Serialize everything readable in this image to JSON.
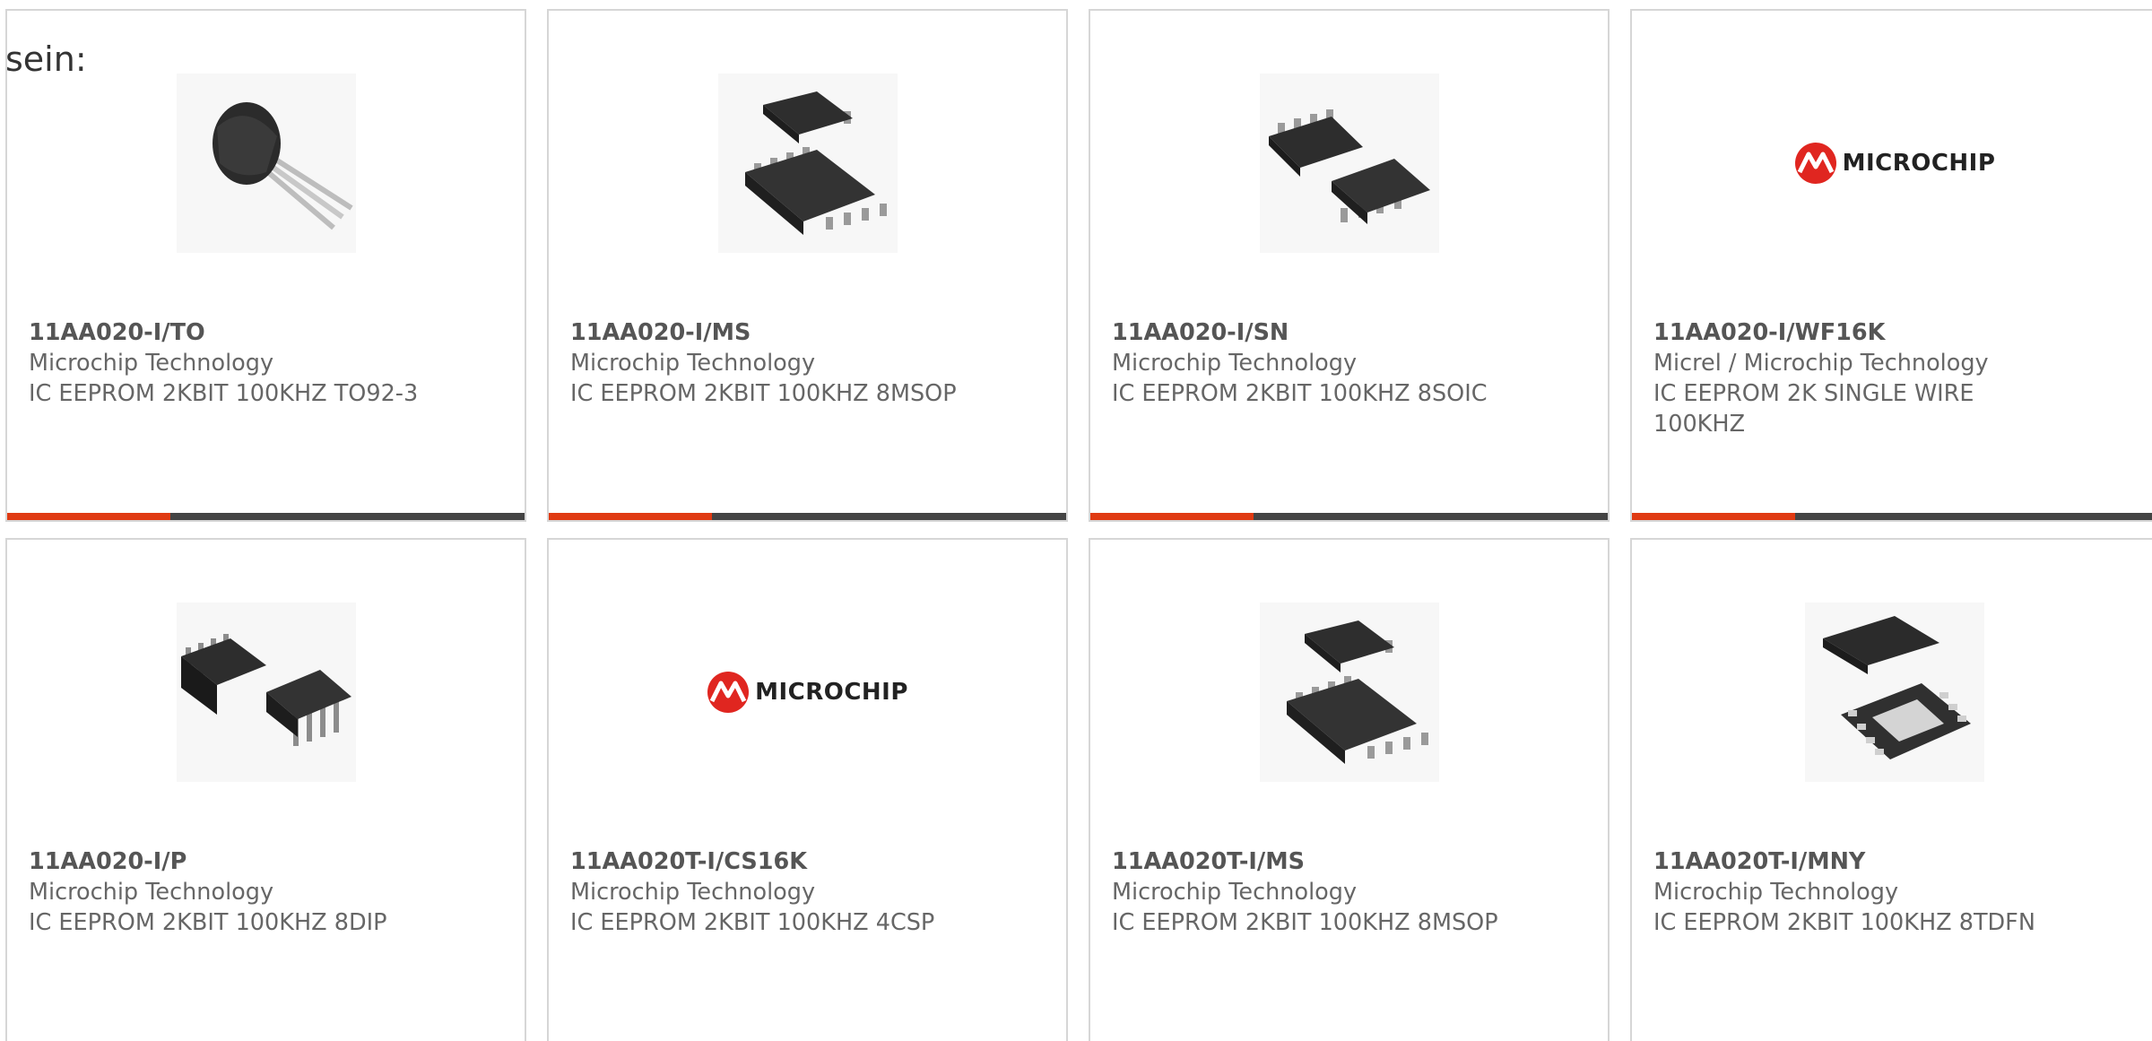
{
  "prefix_text": "sein:",
  "products": [
    {
      "part": "11AA020-I/TO",
      "maker": "Microchip Technology",
      "desc": "IC EEPROM 2KBIT 100KHZ TO92-3",
      "image_icon": "to92-package-icon"
    },
    {
      "part": "11AA020-I/MS",
      "maker": "Microchip Technology",
      "desc": "IC EEPROM 2KBIT 100KHZ 8MSOP",
      "image_icon": "msop-package-icon"
    },
    {
      "part": "11AA020-I/SN",
      "maker": "Microchip Technology",
      "desc": "IC EEPROM 2KBIT 100KHZ 8SOIC",
      "image_icon": "soic-package-icon"
    },
    {
      "part": "11AA020-I/WF16K",
      "maker": "Micrel / Microchip Technology",
      "desc": "IC EEPROM 2K SINGLE WIRE 100KHZ",
      "image_icon": "microchip-logo-icon",
      "logo_text": "MICROCHIP"
    },
    {
      "part": "11AA020-I/P",
      "maker": "Microchip Technology",
      "desc": "IC EEPROM 2KBIT 100KHZ 8DIP",
      "image_icon": "dip-package-icon"
    },
    {
      "part": "11AA020T-I/CS16K",
      "maker": "Microchip Technology",
      "desc": "IC EEPROM 2KBIT 100KHZ 4CSP",
      "image_icon": "microchip-logo-icon",
      "logo_text": "MICROCHIP"
    },
    {
      "part": "11AA020T-I/MS",
      "maker": "Microchip Technology",
      "desc": "IC EEPROM 2KBIT 100KHZ 8MSOP",
      "image_icon": "msop-package-icon"
    },
    {
      "part": "11AA020T-I/MNY",
      "maker": "Microchip Technology",
      "desc": "IC EEPROM 2KBIT 100KHZ 8TDFN",
      "image_icon": "tdfn-package-icon"
    }
  ],
  "colors": {
    "accent": "#e03a12",
    "bar": "#444444",
    "border": "#d6d6d6",
    "logo_red": "#e02620"
  }
}
